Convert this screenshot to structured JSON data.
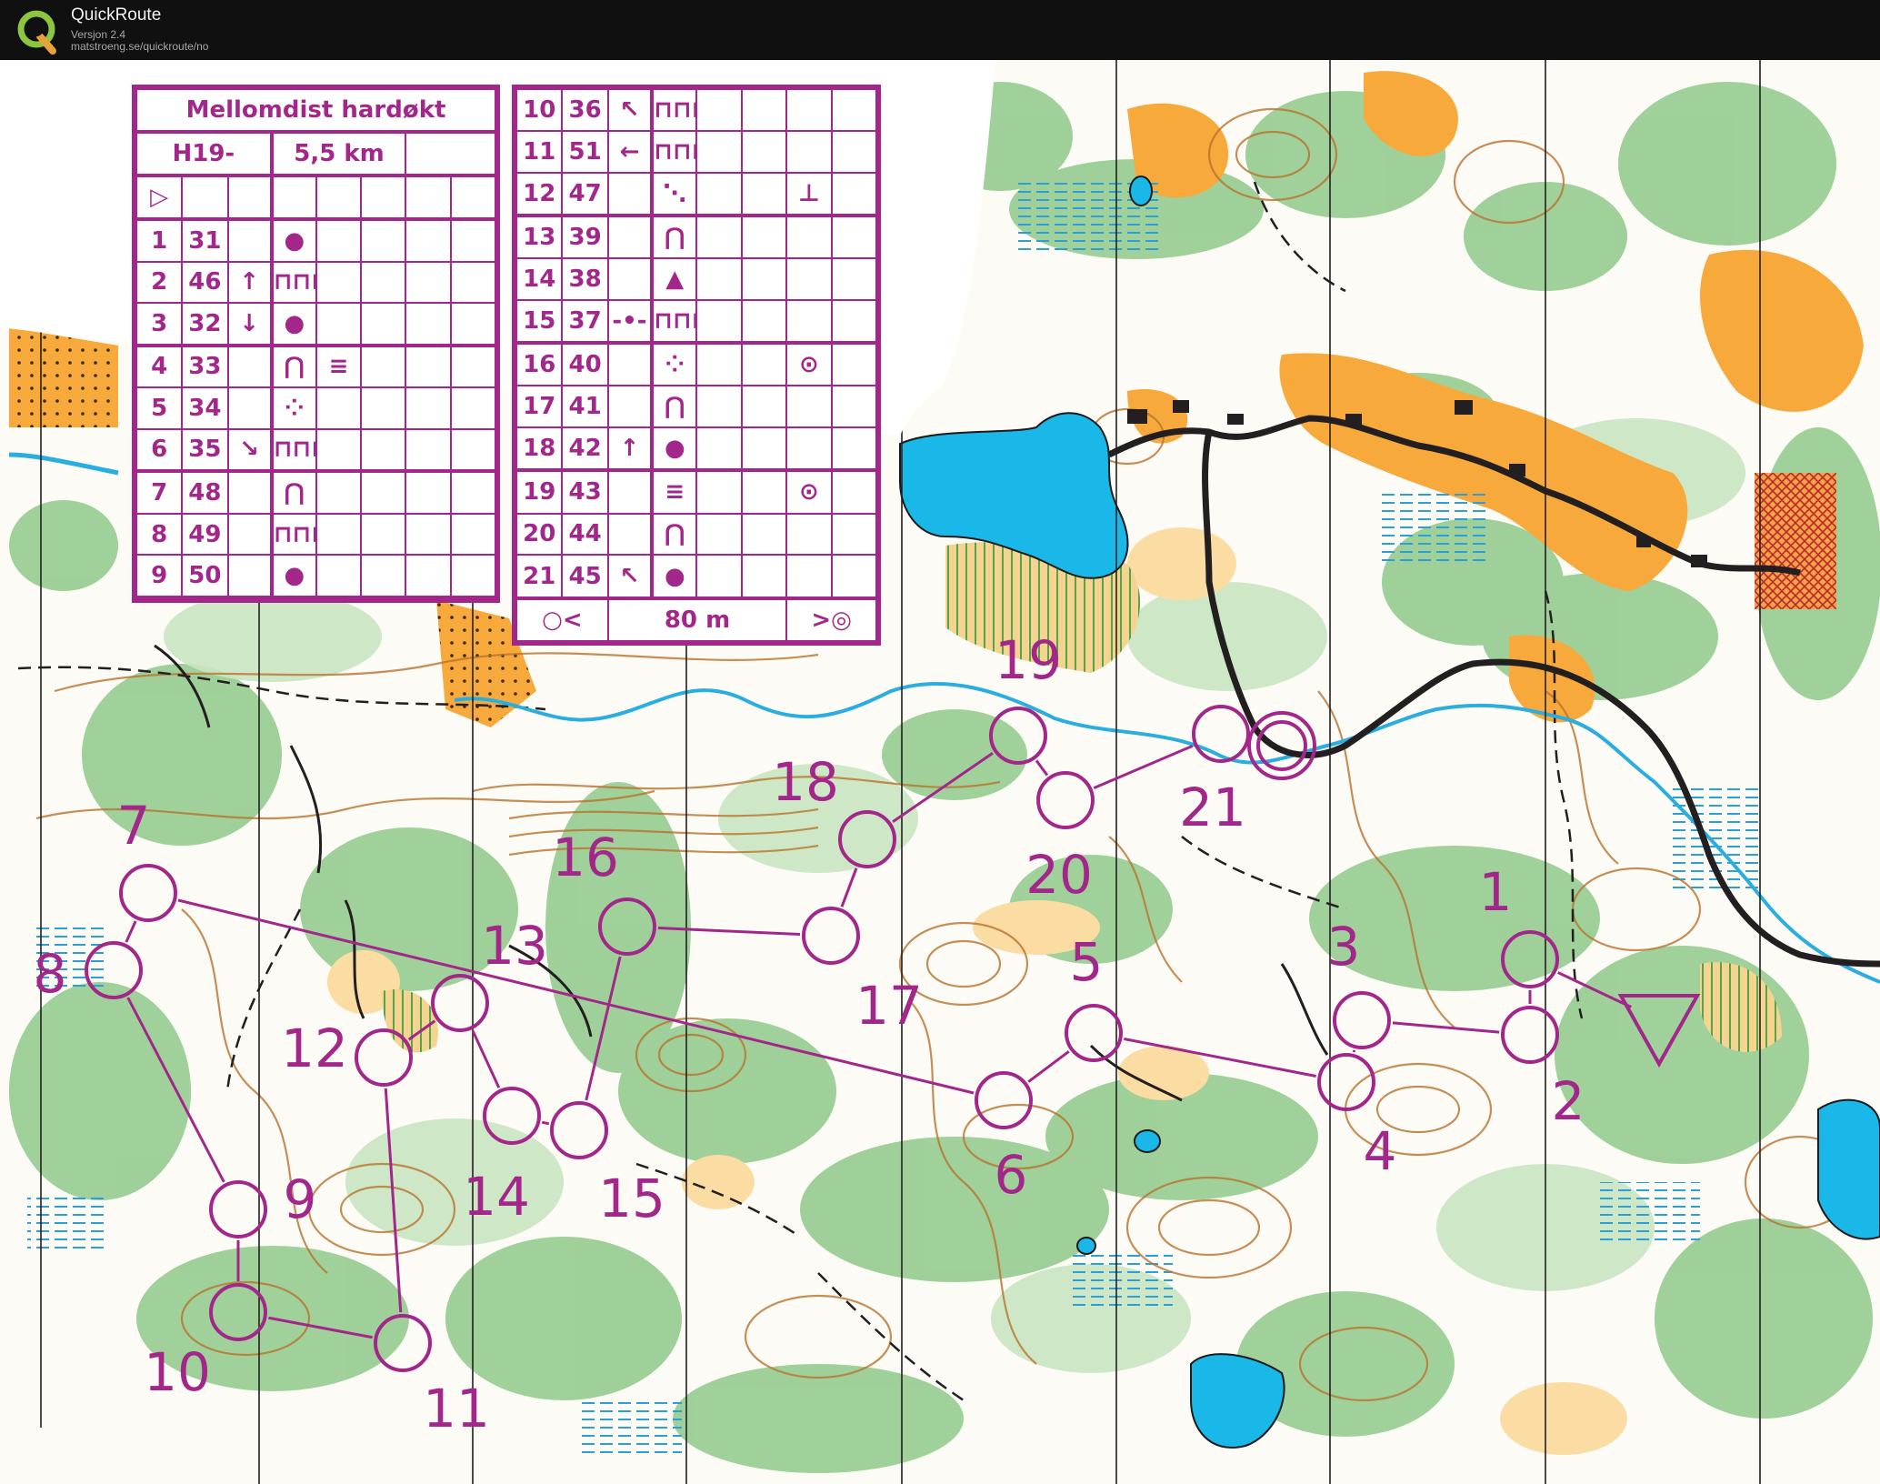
{
  "app": {
    "title": "QuickRoute",
    "version": "Versjon 2.4",
    "url": "matstroeng.se/quickroute/no",
    "logo_icon": "quickroute-q-logo-icon"
  },
  "course": {
    "title": "Mellomdist hardøkt",
    "class_name": "H19-",
    "length": "5,5 km",
    "finish_distance": "80 m",
    "color": "#a3278a"
  },
  "control_descriptions": [
    {
      "num": "1",
      "code": "31",
      "dir": "",
      "feature": "●",
      "detail": "",
      "extra": ""
    },
    {
      "num": "2",
      "code": "46",
      "dir": "↑",
      "feature": "⊓⊓⊓",
      "detail": "",
      "extra": ""
    },
    {
      "num": "3",
      "code": "32",
      "dir": "↓",
      "feature": "●",
      "detail": "",
      "extra": ""
    },
    {
      "num": "4",
      "code": "33",
      "dir": "",
      "feature": "⋂",
      "detail": "≡",
      "extra": ""
    },
    {
      "num": "5",
      "code": "34",
      "dir": "",
      "feature": "⁘",
      "detail": "",
      "extra": ""
    },
    {
      "num": "6",
      "code": "35",
      "dir": "↘",
      "feature": "⊓⊓⊓",
      "detail": "",
      "extra": ""
    },
    {
      "num": "7",
      "code": "48",
      "dir": "",
      "feature": "⋂",
      "detail": "",
      "extra": ""
    },
    {
      "num": "8",
      "code": "49",
      "dir": "",
      "feature": "⊓⊓⊓",
      "detail": "",
      "extra": ""
    },
    {
      "num": "9",
      "code": "50",
      "dir": "",
      "feature": "●",
      "detail": "",
      "extra": ""
    },
    {
      "num": "10",
      "code": "36",
      "dir": "↖",
      "feature": "⊓⊓⊓",
      "detail": "",
      "extra": ""
    },
    {
      "num": "11",
      "code": "51",
      "dir": "←",
      "feature": "⊓⊓⊓",
      "detail": "",
      "extra": ""
    },
    {
      "num": "12",
      "code": "47",
      "dir": "",
      "feature": "⋱",
      "detail": "",
      "extra": "⊥"
    },
    {
      "num": "13",
      "code": "39",
      "dir": "",
      "feature": "⋂",
      "detail": "",
      "extra": ""
    },
    {
      "num": "14",
      "code": "38",
      "dir": "",
      "feature": "▲",
      "detail": "",
      "extra": ""
    },
    {
      "num": "15",
      "code": "37",
      "dir": "-•-",
      "feature": "⊓⊓⊓",
      "detail": "",
      "extra": ""
    },
    {
      "num": "16",
      "code": "40",
      "dir": "",
      "feature": "⁘",
      "detail": "",
      "extra": "⊙"
    },
    {
      "num": "17",
      "code": "41",
      "dir": "",
      "feature": "⋂",
      "detail": "",
      "extra": ""
    },
    {
      "num": "18",
      "code": "42",
      "dir": "↑",
      "feature": "●",
      "detail": "",
      "extra": ""
    },
    {
      "num": "19",
      "code": "43",
      "dir": "",
      "feature": "≡",
      "detail": "",
      "extra": "⊙"
    },
    {
      "num": "20",
      "code": "44",
      "dir": "",
      "feature": "⋂",
      "detail": "",
      "extra": ""
    },
    {
      "num": "21",
      "code": "45",
      "dir": "↖",
      "feature": "●",
      "detail": "",
      "extra": ""
    }
  ],
  "map": {
    "controls": [
      {
        "label": "1"
      },
      {
        "label": "2"
      },
      {
        "label": "3"
      },
      {
        "label": "4"
      },
      {
        "label": "5"
      },
      {
        "label": "6"
      },
      {
        "label": "7"
      },
      {
        "label": "8"
      },
      {
        "label": "9"
      },
      {
        "label": "10"
      },
      {
        "label": "11"
      },
      {
        "label": "12"
      },
      {
        "label": "13"
      },
      {
        "label": "14"
      },
      {
        "label": "15"
      },
      {
        "label": "16"
      },
      {
        "label": "17"
      },
      {
        "label": "18"
      },
      {
        "label": "19"
      },
      {
        "label": "20"
      },
      {
        "label": "21"
      }
    ],
    "colors": {
      "course": "#a3278a",
      "open_land": "#f7a93b",
      "vegetation": "#8fc98a",
      "water": "#1ab8e8",
      "contour": "#b8732e",
      "marsh": "#2a9fd8",
      "road": "#231f20"
    }
  }
}
